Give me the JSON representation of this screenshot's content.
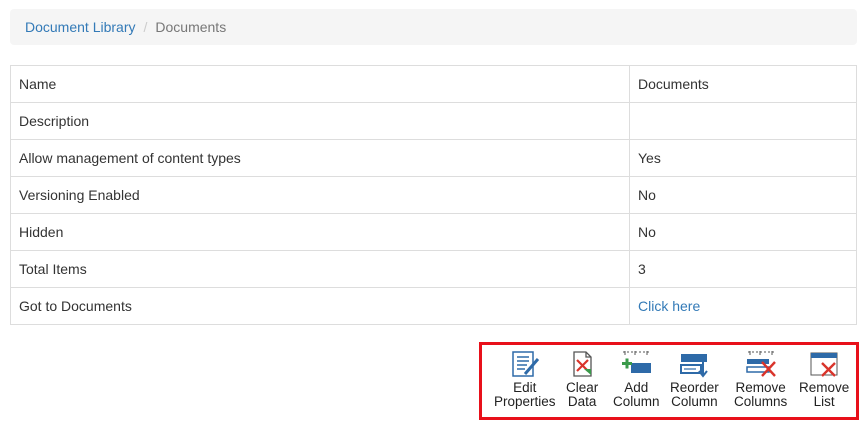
{
  "breadcrumb": {
    "root": "Document Library",
    "separator": "/",
    "current": "Documents"
  },
  "properties": [
    {
      "label": "Name",
      "value": "Documents"
    },
    {
      "label": "Description",
      "value": ""
    },
    {
      "label": "Allow management of content types",
      "value": "Yes"
    },
    {
      "label": "Versioning Enabled",
      "value": "No"
    },
    {
      "label": "Hidden",
      "value": "No"
    },
    {
      "label": "Total Items",
      "value": "3"
    },
    {
      "label": "Got to Documents",
      "value": "Click here"
    }
  ],
  "toolbar": {
    "edit_properties": [
      "Edit",
      "Properties"
    ],
    "clear_data": [
      "Clear",
      "Data"
    ],
    "add_column": [
      "Add",
      "Column"
    ],
    "reorder_column": [
      "Reorder",
      "Column"
    ],
    "remove_columns": [
      "Remove",
      "Columns"
    ],
    "remove_list": [
      "Remove",
      "List"
    ]
  },
  "colors": {
    "link": "#337ab7",
    "highlight_border": "#e8101a",
    "icon_blue": "#2e6aa8",
    "icon_red": "#d9342b",
    "icon_green": "#3a9a4a"
  }
}
